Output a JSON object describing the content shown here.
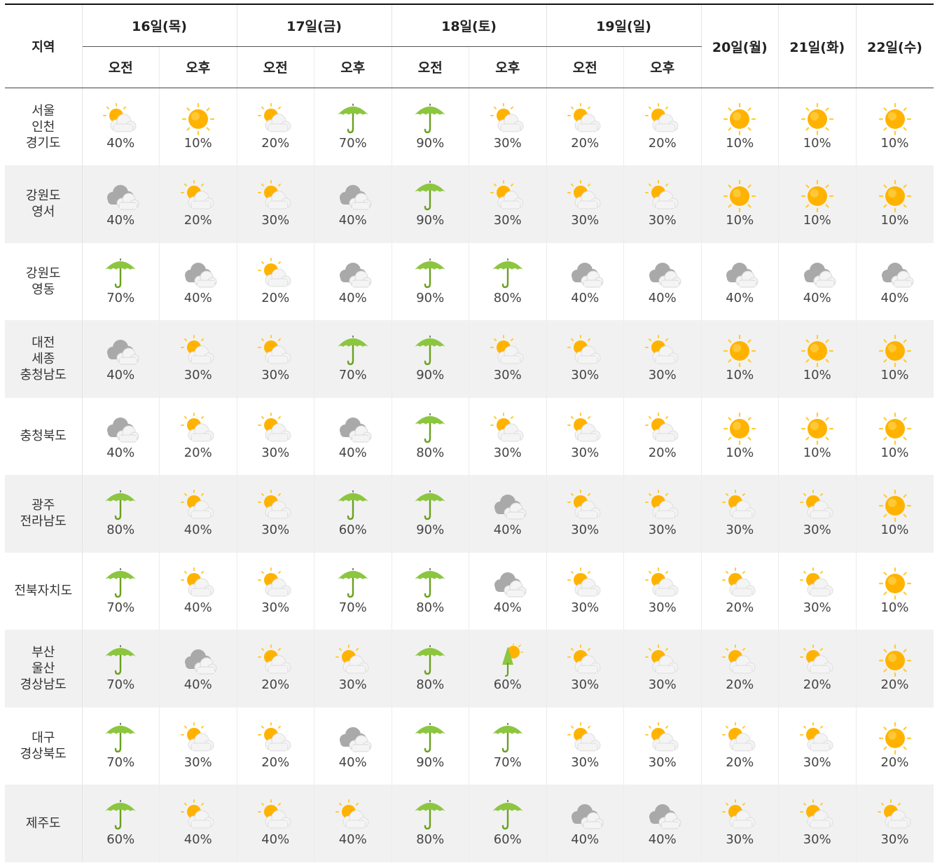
{
  "header": {
    "region_label": "지역",
    "days": [
      "16일(목)",
      "17일(금)",
      "18일(토)",
      "19일(일)",
      "20일(월)",
      "21일(화)",
      "22일(수)"
    ],
    "am_label": "오전",
    "pm_label": "오후"
  },
  "rows": [
    {
      "region": [
        "서울",
        "인천",
        "경기도"
      ],
      "cells": [
        {
          "icon": "partly-cloudy-icon",
          "pct": "40%"
        },
        {
          "icon": "sunny-icon",
          "pct": "10%"
        },
        {
          "icon": "partly-cloudy-icon",
          "pct": "20%"
        },
        {
          "icon": "rain-umbrella-icon",
          "pct": "70%"
        },
        {
          "icon": "rain-umbrella-icon",
          "pct": "90%"
        },
        {
          "icon": "partly-cloudy-icon",
          "pct": "30%"
        },
        {
          "icon": "partly-cloudy-icon",
          "pct": "20%"
        },
        {
          "icon": "partly-cloudy-icon",
          "pct": "20%"
        },
        {
          "icon": "sunny-icon",
          "pct": "10%"
        },
        {
          "icon": "sunny-icon",
          "pct": "10%"
        },
        {
          "icon": "sunny-icon",
          "pct": "10%"
        }
      ]
    },
    {
      "region": [
        "강원도",
        "영서"
      ],
      "cells": [
        {
          "icon": "cloudy-icon",
          "pct": "40%"
        },
        {
          "icon": "partly-cloudy-icon",
          "pct": "20%"
        },
        {
          "icon": "partly-cloudy-icon",
          "pct": "30%"
        },
        {
          "icon": "cloudy-icon",
          "pct": "40%"
        },
        {
          "icon": "rain-umbrella-icon",
          "pct": "90%"
        },
        {
          "icon": "partly-cloudy-icon",
          "pct": "30%"
        },
        {
          "icon": "partly-cloudy-icon",
          "pct": "30%"
        },
        {
          "icon": "partly-cloudy-icon",
          "pct": "30%"
        },
        {
          "icon": "sunny-icon",
          "pct": "10%"
        },
        {
          "icon": "sunny-icon",
          "pct": "10%"
        },
        {
          "icon": "sunny-icon",
          "pct": "10%"
        }
      ]
    },
    {
      "region": [
        "강원도",
        "영동"
      ],
      "cells": [
        {
          "icon": "rain-umbrella-icon",
          "pct": "70%"
        },
        {
          "icon": "cloudy-icon",
          "pct": "40%"
        },
        {
          "icon": "partly-cloudy-icon",
          "pct": "20%"
        },
        {
          "icon": "cloudy-icon",
          "pct": "40%"
        },
        {
          "icon": "rain-umbrella-icon",
          "pct": "90%"
        },
        {
          "icon": "rain-umbrella-icon",
          "pct": "80%"
        },
        {
          "icon": "cloudy-icon",
          "pct": "40%"
        },
        {
          "icon": "cloudy-icon",
          "pct": "40%"
        },
        {
          "icon": "cloudy-icon",
          "pct": "40%"
        },
        {
          "icon": "cloudy-icon",
          "pct": "40%"
        },
        {
          "icon": "cloudy-icon",
          "pct": "40%"
        }
      ]
    },
    {
      "region": [
        "대전",
        "세종",
        "충청남도"
      ],
      "cells": [
        {
          "icon": "cloudy-icon",
          "pct": "40%"
        },
        {
          "icon": "partly-cloudy-icon",
          "pct": "30%"
        },
        {
          "icon": "partly-cloudy-icon",
          "pct": "30%"
        },
        {
          "icon": "rain-umbrella-icon",
          "pct": "70%"
        },
        {
          "icon": "rain-umbrella-icon",
          "pct": "90%"
        },
        {
          "icon": "partly-cloudy-icon",
          "pct": "30%"
        },
        {
          "icon": "partly-cloudy-icon",
          "pct": "30%"
        },
        {
          "icon": "partly-cloudy-icon",
          "pct": "30%"
        },
        {
          "icon": "sunny-icon",
          "pct": "10%"
        },
        {
          "icon": "sunny-icon",
          "pct": "10%"
        },
        {
          "icon": "sunny-icon",
          "pct": "10%"
        }
      ]
    },
    {
      "region": [
        "충청북도"
      ],
      "cells": [
        {
          "icon": "cloudy-icon",
          "pct": "40%"
        },
        {
          "icon": "partly-cloudy-icon",
          "pct": "20%"
        },
        {
          "icon": "partly-cloudy-icon",
          "pct": "30%"
        },
        {
          "icon": "cloudy-icon",
          "pct": "40%"
        },
        {
          "icon": "rain-umbrella-icon",
          "pct": "80%"
        },
        {
          "icon": "partly-cloudy-icon",
          "pct": "30%"
        },
        {
          "icon": "partly-cloudy-icon",
          "pct": "30%"
        },
        {
          "icon": "partly-cloudy-icon",
          "pct": "20%"
        },
        {
          "icon": "sunny-icon",
          "pct": "10%"
        },
        {
          "icon": "sunny-icon",
          "pct": "10%"
        },
        {
          "icon": "sunny-icon",
          "pct": "10%"
        }
      ]
    },
    {
      "region": [
        "광주",
        "전라남도"
      ],
      "cells": [
        {
          "icon": "rain-umbrella-icon",
          "pct": "80%"
        },
        {
          "icon": "partly-cloudy-icon",
          "pct": "40%"
        },
        {
          "icon": "partly-cloudy-icon",
          "pct": "30%"
        },
        {
          "icon": "rain-umbrella-icon",
          "pct": "60%"
        },
        {
          "icon": "rain-umbrella-icon",
          "pct": "90%"
        },
        {
          "icon": "cloudy-icon",
          "pct": "40%"
        },
        {
          "icon": "partly-cloudy-icon",
          "pct": "30%"
        },
        {
          "icon": "partly-cloudy-icon",
          "pct": "30%"
        },
        {
          "icon": "partly-cloudy-icon",
          "pct": "30%"
        },
        {
          "icon": "partly-cloudy-icon",
          "pct": "30%"
        },
        {
          "icon": "sunny-icon",
          "pct": "10%"
        }
      ]
    },
    {
      "region": [
        "전북자치도"
      ],
      "cells": [
        {
          "icon": "rain-umbrella-icon",
          "pct": "70%"
        },
        {
          "icon": "partly-cloudy-icon",
          "pct": "40%"
        },
        {
          "icon": "partly-cloudy-icon",
          "pct": "30%"
        },
        {
          "icon": "rain-umbrella-icon",
          "pct": "70%"
        },
        {
          "icon": "rain-umbrella-icon",
          "pct": "80%"
        },
        {
          "icon": "cloudy-icon",
          "pct": "40%"
        },
        {
          "icon": "partly-cloudy-icon",
          "pct": "30%"
        },
        {
          "icon": "partly-cloudy-icon",
          "pct": "30%"
        },
        {
          "icon": "partly-cloudy-icon",
          "pct": "20%"
        },
        {
          "icon": "partly-cloudy-icon",
          "pct": "30%"
        },
        {
          "icon": "sunny-icon",
          "pct": "10%"
        }
      ]
    },
    {
      "region": [
        "부산",
        "울산",
        "경상남도"
      ],
      "cells": [
        {
          "icon": "rain-umbrella-icon",
          "pct": "70%"
        },
        {
          "icon": "cloudy-icon",
          "pct": "40%"
        },
        {
          "icon": "partly-cloudy-icon",
          "pct": "20%"
        },
        {
          "icon": "partly-cloudy-icon",
          "pct": "30%"
        },
        {
          "icon": "rain-umbrella-icon",
          "pct": "80%"
        },
        {
          "icon": "sun-shower-icon",
          "pct": "60%"
        },
        {
          "icon": "partly-cloudy-icon",
          "pct": "30%"
        },
        {
          "icon": "partly-cloudy-icon",
          "pct": "30%"
        },
        {
          "icon": "partly-cloudy-icon",
          "pct": "20%"
        },
        {
          "icon": "partly-cloudy-icon",
          "pct": "20%"
        },
        {
          "icon": "sunny-icon",
          "pct": "20%"
        }
      ]
    },
    {
      "region": [
        "대구",
        "경상북도"
      ],
      "cells": [
        {
          "icon": "rain-umbrella-icon",
          "pct": "70%"
        },
        {
          "icon": "partly-cloudy-icon",
          "pct": "30%"
        },
        {
          "icon": "partly-cloudy-icon",
          "pct": "20%"
        },
        {
          "icon": "cloudy-icon",
          "pct": "40%"
        },
        {
          "icon": "rain-umbrella-icon",
          "pct": "90%"
        },
        {
          "icon": "rain-umbrella-icon",
          "pct": "70%"
        },
        {
          "icon": "partly-cloudy-icon",
          "pct": "30%"
        },
        {
          "icon": "partly-cloudy-icon",
          "pct": "30%"
        },
        {
          "icon": "partly-cloudy-icon",
          "pct": "20%"
        },
        {
          "icon": "partly-cloudy-icon",
          "pct": "30%"
        },
        {
          "icon": "sunny-icon",
          "pct": "20%"
        }
      ]
    },
    {
      "region": [
        "제주도"
      ],
      "cells": [
        {
          "icon": "rain-umbrella-icon",
          "pct": "60%"
        },
        {
          "icon": "partly-cloudy-icon",
          "pct": "40%"
        },
        {
          "icon": "partly-cloudy-icon",
          "pct": "40%"
        },
        {
          "icon": "partly-cloudy-icon",
          "pct": "40%"
        },
        {
          "icon": "rain-umbrella-icon",
          "pct": "80%"
        },
        {
          "icon": "rain-umbrella-icon",
          "pct": "60%"
        },
        {
          "icon": "cloudy-icon",
          "pct": "40%"
        },
        {
          "icon": "cloudy-icon",
          "pct": "40%"
        },
        {
          "icon": "partly-cloudy-icon",
          "pct": "30%"
        },
        {
          "icon": "partly-cloudy-icon",
          "pct": "30%"
        },
        {
          "icon": "partly-cloudy-icon",
          "pct": "30%"
        }
      ]
    }
  ],
  "colors": {
    "sun": "#ffb300",
    "sun_rays": "#ffcc33",
    "cloud": "#f4f4f4",
    "dark_cloud": "#a9a9a9",
    "umbrella": "#8cc63f",
    "umbrella_handle": "#6aa01f",
    "shaded_row": "#f1f1f1"
  }
}
